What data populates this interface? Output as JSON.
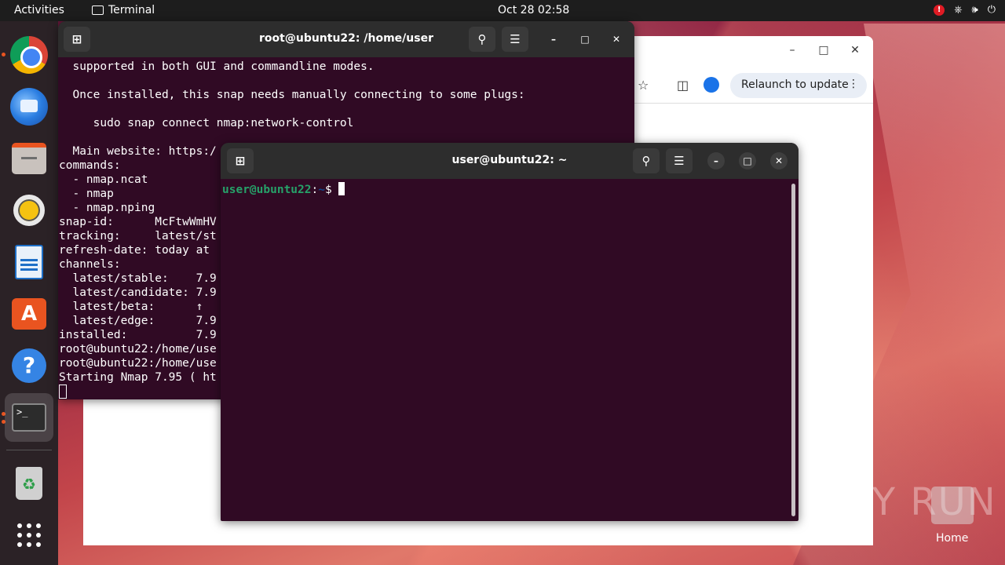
{
  "topbar": {
    "activities": "Activities",
    "app_name": "Terminal",
    "clock": "Oct 28  02:58",
    "tray_icons": [
      "alert-icon",
      "network-icon",
      "volume-icon",
      "power-icon"
    ]
  },
  "dock": {
    "items": [
      "chrome",
      "thunderbird",
      "files",
      "rhythmbox",
      "libreoffice-writer",
      "app-center",
      "help",
      "terminal",
      "trash",
      "show-apps"
    ]
  },
  "browser": {
    "relaunch_label": "Relaunch to update"
  },
  "terminal_root": {
    "title": "root@ubuntu22: /home/user",
    "lines": [
      "  supported in both GUI and commandline modes.",
      "",
      "  Once installed, this snap needs manually connecting to some plugs:",
      "",
      "     sudo snap connect nmap:network-control",
      "",
      "  Main website: https:/",
      "commands:",
      "  - nmap.ncat",
      "  - nmap",
      "  - nmap.nping",
      "snap-id:      McFtwWmHV",
      "tracking:     latest/st",
      "refresh-date: today at ",
      "channels:",
      "  latest/stable:    7.9",
      "  latest/candidate: 7.9",
      "  latest/beta:      ↑",
      "  latest/edge:      7.9",
      "installed:          7.9",
      "root@ubuntu22:/home/use",
      "root@ubuntu22:/home/use",
      "Starting Nmap 7.95 ( ht"
    ]
  },
  "terminal_user": {
    "title": "user@ubuntu22: ~",
    "prompt_user": "user@ubuntu22",
    "prompt_sep": ":",
    "prompt_path": "~",
    "prompt_symbol": "$ "
  },
  "desktop": {
    "watermark": "ANY RUN",
    "home_label": "Home"
  }
}
